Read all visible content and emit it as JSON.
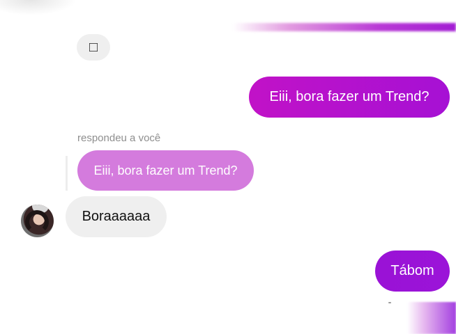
{
  "conversation": {
    "sticker_message": {
      "glyph": "□"
    },
    "sent_message_1": {
      "text": "Eiii, bora fazer um Trend?"
    },
    "reply": {
      "label": "respondeu a você",
      "quoted_text": "Eiii, bora fazer um Trend?"
    },
    "received_message": {
      "text": "Boraaaaaa"
    },
    "sent_message_2": {
      "text": "Tábom"
    }
  },
  "colors": {
    "sent_bubble": "#b012cf",
    "quoted_bubble": "#d47bdd",
    "received_bubble": "#efefef",
    "reply_label": "#8e8e8e"
  }
}
